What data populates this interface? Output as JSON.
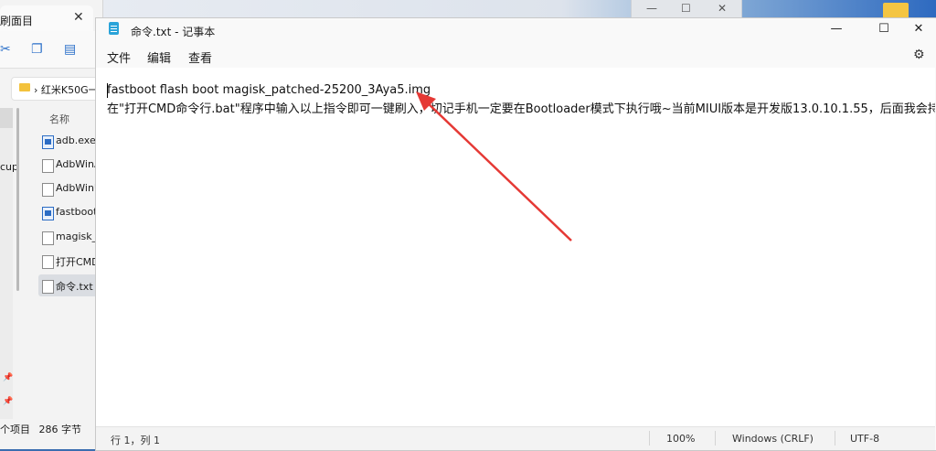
{
  "background": {
    "window_controls": [
      "—",
      "☐",
      "✕"
    ]
  },
  "explorer": {
    "tab_title": "刷面目",
    "tab_close": "✕",
    "breadcrumb_sep": "›",
    "breadcrumb": "红米K50G一",
    "column_name": "名称",
    "nav_label": "cup",
    "files": [
      {
        "name": "adb.exe",
        "icon": "exe-icon"
      },
      {
        "name": "AdbWinA",
        "icon": "file-icon"
      },
      {
        "name": "AdbWinU",
        "icon": "file-icon"
      },
      {
        "name": "fastboot.",
        "icon": "exe-icon"
      },
      {
        "name": "magisk_p",
        "icon": "file-icon"
      },
      {
        "name": "打开CMD",
        "icon": "file-icon"
      },
      {
        "name": "命令.txt",
        "icon": "file-icon"
      }
    ],
    "selected_file": "命令.txt",
    "status_count": "个项目",
    "status_size": "286 字节"
  },
  "notepad": {
    "title": "命令.txt - 记事本",
    "controls": {
      "minimize": "—",
      "maximize": "☐",
      "close": "✕"
    },
    "menu": [
      "文件",
      "编辑",
      "查看"
    ],
    "lines": [
      "fastboot flash boot magisk_patched-25200_3Aya5.img",
      "在\"打开CMD命令行.bat\"程序中输入以上指令即可一键刷入，切记手机一定要在Bootloader模式下执行哦~当前MIUI版本是开发版13.0.10.1.55，后面我会持续"
    ],
    "status": {
      "position": "行 1，列 1",
      "zoom": "100%",
      "line_ending": "Windows (CRLF)",
      "encoding": "UTF-8"
    },
    "annotation_color": "#e53935"
  }
}
